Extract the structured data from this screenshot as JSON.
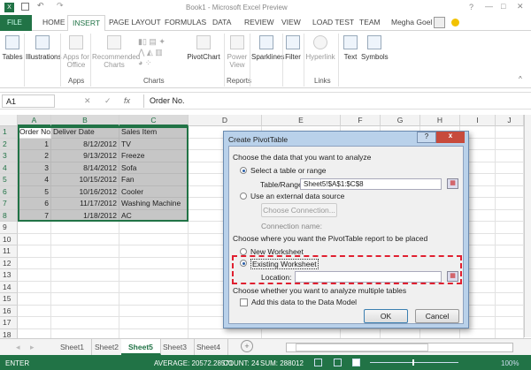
{
  "window": {
    "title": "Book1 - Microsoft Excel Preview",
    "help": "?",
    "user": "Megha Goel"
  },
  "tabs": [
    "FILE",
    "HOME",
    "INSERT",
    "PAGE LAYOUT",
    "FORMULAS",
    "DATA",
    "REVIEW",
    "VIEW",
    "LOAD TEST",
    "TEAM"
  ],
  "ribbon": {
    "buttons": [
      "Tables",
      "Illustrations",
      "Apps for Office",
      "Recommended Charts",
      "PivotChart",
      "Power View",
      "Sparklines",
      "Filter",
      "Hyperlink",
      "Text",
      "Symbols"
    ],
    "groups": [
      "Apps",
      "Charts",
      "Reports",
      "Links"
    ]
  },
  "formula_bar": {
    "name_box": "A1",
    "fx": "fx",
    "value": "Order No."
  },
  "columns": [
    "A",
    "B",
    "C",
    "D",
    "E",
    "F",
    "G",
    "H",
    "I",
    "J"
  ],
  "rows": [
    "1",
    "2",
    "3",
    "4",
    "5",
    "6",
    "7",
    "8",
    "9",
    "10",
    "11",
    "12",
    "13",
    "14",
    "15",
    "16",
    "17",
    "18"
  ],
  "table": {
    "headers": [
      "Order No.",
      "Deliver Date",
      "Sales Item"
    ],
    "rows": [
      [
        "1",
        "8/12/2012",
        "TV"
      ],
      [
        "2",
        "9/13/2012",
        "Freeze"
      ],
      [
        "3",
        "8/14/2012",
        "Sofa"
      ],
      [
        "4",
        "10/15/2012",
        "Fan"
      ],
      [
        "5",
        "10/16/2012",
        "Cooler"
      ],
      [
        "6",
        "11/17/2012",
        "Washing Machine"
      ],
      [
        "7",
        "1/18/2012",
        "AC"
      ]
    ]
  },
  "dialog": {
    "title": "Create PivotTable",
    "help": "?",
    "close": "x",
    "section1": "Choose the data that you want to analyze",
    "opt_select": "Select a table or range",
    "range_label": "Table/Range:",
    "range_value": "Sheet5!$A$1:$C$8",
    "opt_external": "Use an external data source",
    "choose_conn": "Choose Connection...",
    "conn_name": "Connection name:",
    "section2": "Choose where you want the PivotTable report to be placed",
    "opt_new": "New Worksheet",
    "opt_existing": "Existing Worksheet",
    "location_label": "Location:",
    "location_value": "",
    "section3": "Choose whether you want to analyze multiple tables",
    "data_model": "Add this data to the Data Model",
    "ok": "OK",
    "cancel": "Cancel"
  },
  "sheets": [
    "Sheet1",
    "Sheet2",
    "Sheet5",
    "Sheet3",
    "Sheet4"
  ],
  "active_sheet": "Sheet5",
  "status": {
    "mode": "ENTER",
    "average": "AVERAGE: 20572.28571",
    "count": "COUNT: 24",
    "sum": "SUM: 288012",
    "zoom": "100%"
  },
  "colors": {
    "accent": "#217346",
    "highlight": "#e02030"
  }
}
